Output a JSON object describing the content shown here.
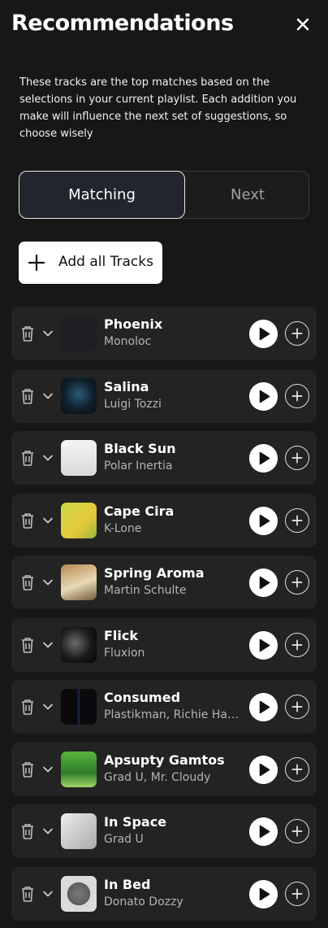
{
  "header": {
    "title": "Recommendations"
  },
  "description": "These tracks are the top matches based on the selections in your current playlist. Each addition you make will influence the next set of suggestions, so choose wisely",
  "tabs": [
    {
      "label": "Matching",
      "active": true
    },
    {
      "label": "Next",
      "active": false
    }
  ],
  "add_all_label": "Add all Tracks",
  "tracks": [
    {
      "title": "Phoenix",
      "artist": "Monoloc"
    },
    {
      "title": "Salina",
      "artist": "Luigi Tozzi"
    },
    {
      "title": "Black Sun",
      "artist": "Polar Inertia"
    },
    {
      "title": "Cape Cira",
      "artist": "K-Lone"
    },
    {
      "title": "Spring Aroma",
      "artist": "Martin Schulte"
    },
    {
      "title": "Flick",
      "artist": "Fluxion"
    },
    {
      "title": "Consumed",
      "artist": "Plastikman, Richie Hawtin"
    },
    {
      "title": "Apsupty Gamtos",
      "artist": "Grad U, Mr. Cloudy"
    },
    {
      "title": "In Space",
      "artist": "Grad U"
    },
    {
      "title": "In Bed",
      "artist": "Donato Dozzy"
    }
  ],
  "icons": {
    "close": "close-icon",
    "add": "plus-icon",
    "delete": "trash-icon",
    "expand": "chevron-down-icon",
    "play": "play-icon"
  },
  "colors": {
    "background": "#171717",
    "row_background": "#232323",
    "primary_text": "#ffffff",
    "secondary_text": "#b4b4b4"
  }
}
